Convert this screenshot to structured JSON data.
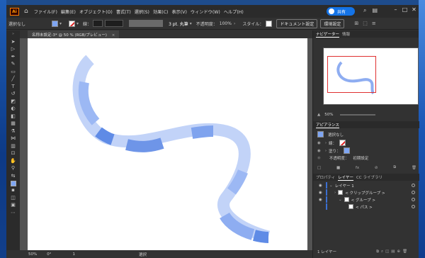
{
  "app": {
    "logo": "Ai"
  },
  "menu": [
    "ファイル(F)",
    "編集(E)",
    "オブジェクト(O)",
    "書式(T)",
    "選択(S)",
    "効果(C)",
    "表示(V)",
    "ウィンドウ(W)",
    "ヘルプ(H)"
  ],
  "titlebar": {
    "share_label": "共有"
  },
  "control_bar": {
    "selection_label": "選択なし",
    "stroke_label": "線：",
    "stroke_profile": "3 pt. 丸筆",
    "opacity_label": "不透明度：",
    "opacity_value": "100%",
    "style_label": "スタイル：",
    "doc_setup_button": "ドキュメント設定",
    "prefs_button": "環境設定"
  },
  "document_tab": {
    "title": "名称未設定-3* @ 50 % (RGB/プレビュー)"
  },
  "status_bar": {
    "zoom": "50%",
    "rotation": "0°",
    "artboard_num": "1",
    "tool": "選択"
  },
  "navigator": {
    "tabs": [
      "ナビゲーター",
      "情報"
    ],
    "zoom": "50%"
  },
  "appearance": {
    "title": "アピアランス",
    "selection": "選択なし",
    "stroke_label": "線：",
    "fill_label": "塗り：",
    "opacity_label": "不透明度：",
    "opacity_value": "初期設定"
  },
  "layers": {
    "tabs": [
      "プロパティ",
      "レイヤー",
      "CC ライブラリ"
    ],
    "rows": [
      {
        "label": "レイヤー 1"
      },
      {
        "label": "< クリップグループ >"
      },
      {
        "label": "< グループ >"
      },
      {
        "label": "< パス >"
      }
    ],
    "footer": "1 レイヤー"
  },
  "colors": {
    "fill": "#7ea5f2",
    "brush_light": "#c2d3f8",
    "brush_dark": "#5f8be6",
    "share": "#1473e6",
    "layer_accent": "#3b6fd1"
  }
}
